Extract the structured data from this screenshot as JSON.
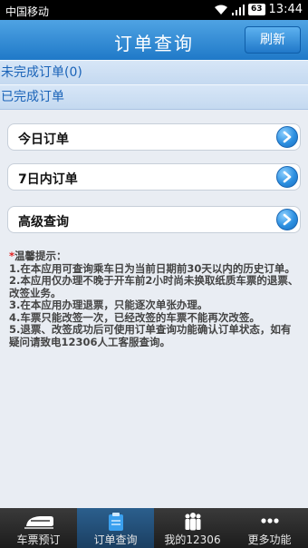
{
  "status_bar": {
    "carrier": "中国移动",
    "battery": "63",
    "time": "13:44"
  },
  "header": {
    "title": "订单查询",
    "refresh_label": "刷新"
  },
  "sections": {
    "incomplete": "未完成订单(0)",
    "complete": "已完成订单"
  },
  "menu": [
    {
      "label": "今日订单"
    },
    {
      "label": "7日内订单"
    },
    {
      "label": "高级查询"
    }
  ],
  "tips": {
    "star": "*",
    "heading": "温馨提示：",
    "lines": [
      "1.在本应用可查询乘车日为当前日期前30天以内的历史订单。",
      "2.本应用仅办理不晚于开车前2小时尚未换取纸质车票的退票、改签业务。",
      "3.在本应用办理退票，只能逐次单张办理。",
      "4.车票只能改签一次，已经改签的车票不能再次改签。",
      "5.退票、改签成功后可使用订单查询功能确认订单状态，如有疑问请致电12306人工客服查询。"
    ]
  },
  "bottom_nav": [
    {
      "label": "车票预订",
      "icon": "train-icon",
      "active": false
    },
    {
      "label": "订单查询",
      "icon": "clipboard-icon",
      "active": true
    },
    {
      "label": "我的12306",
      "icon": "people-icon",
      "active": false
    },
    {
      "label": "更多功能",
      "icon": "more-icon",
      "active": false
    }
  ],
  "colors": {
    "header": "#2a86d4",
    "section_text": "#1a63b8",
    "arrow": "#2c8fe0",
    "nav_bg": "#2a2a2a",
    "nav_active": "#245a86"
  }
}
